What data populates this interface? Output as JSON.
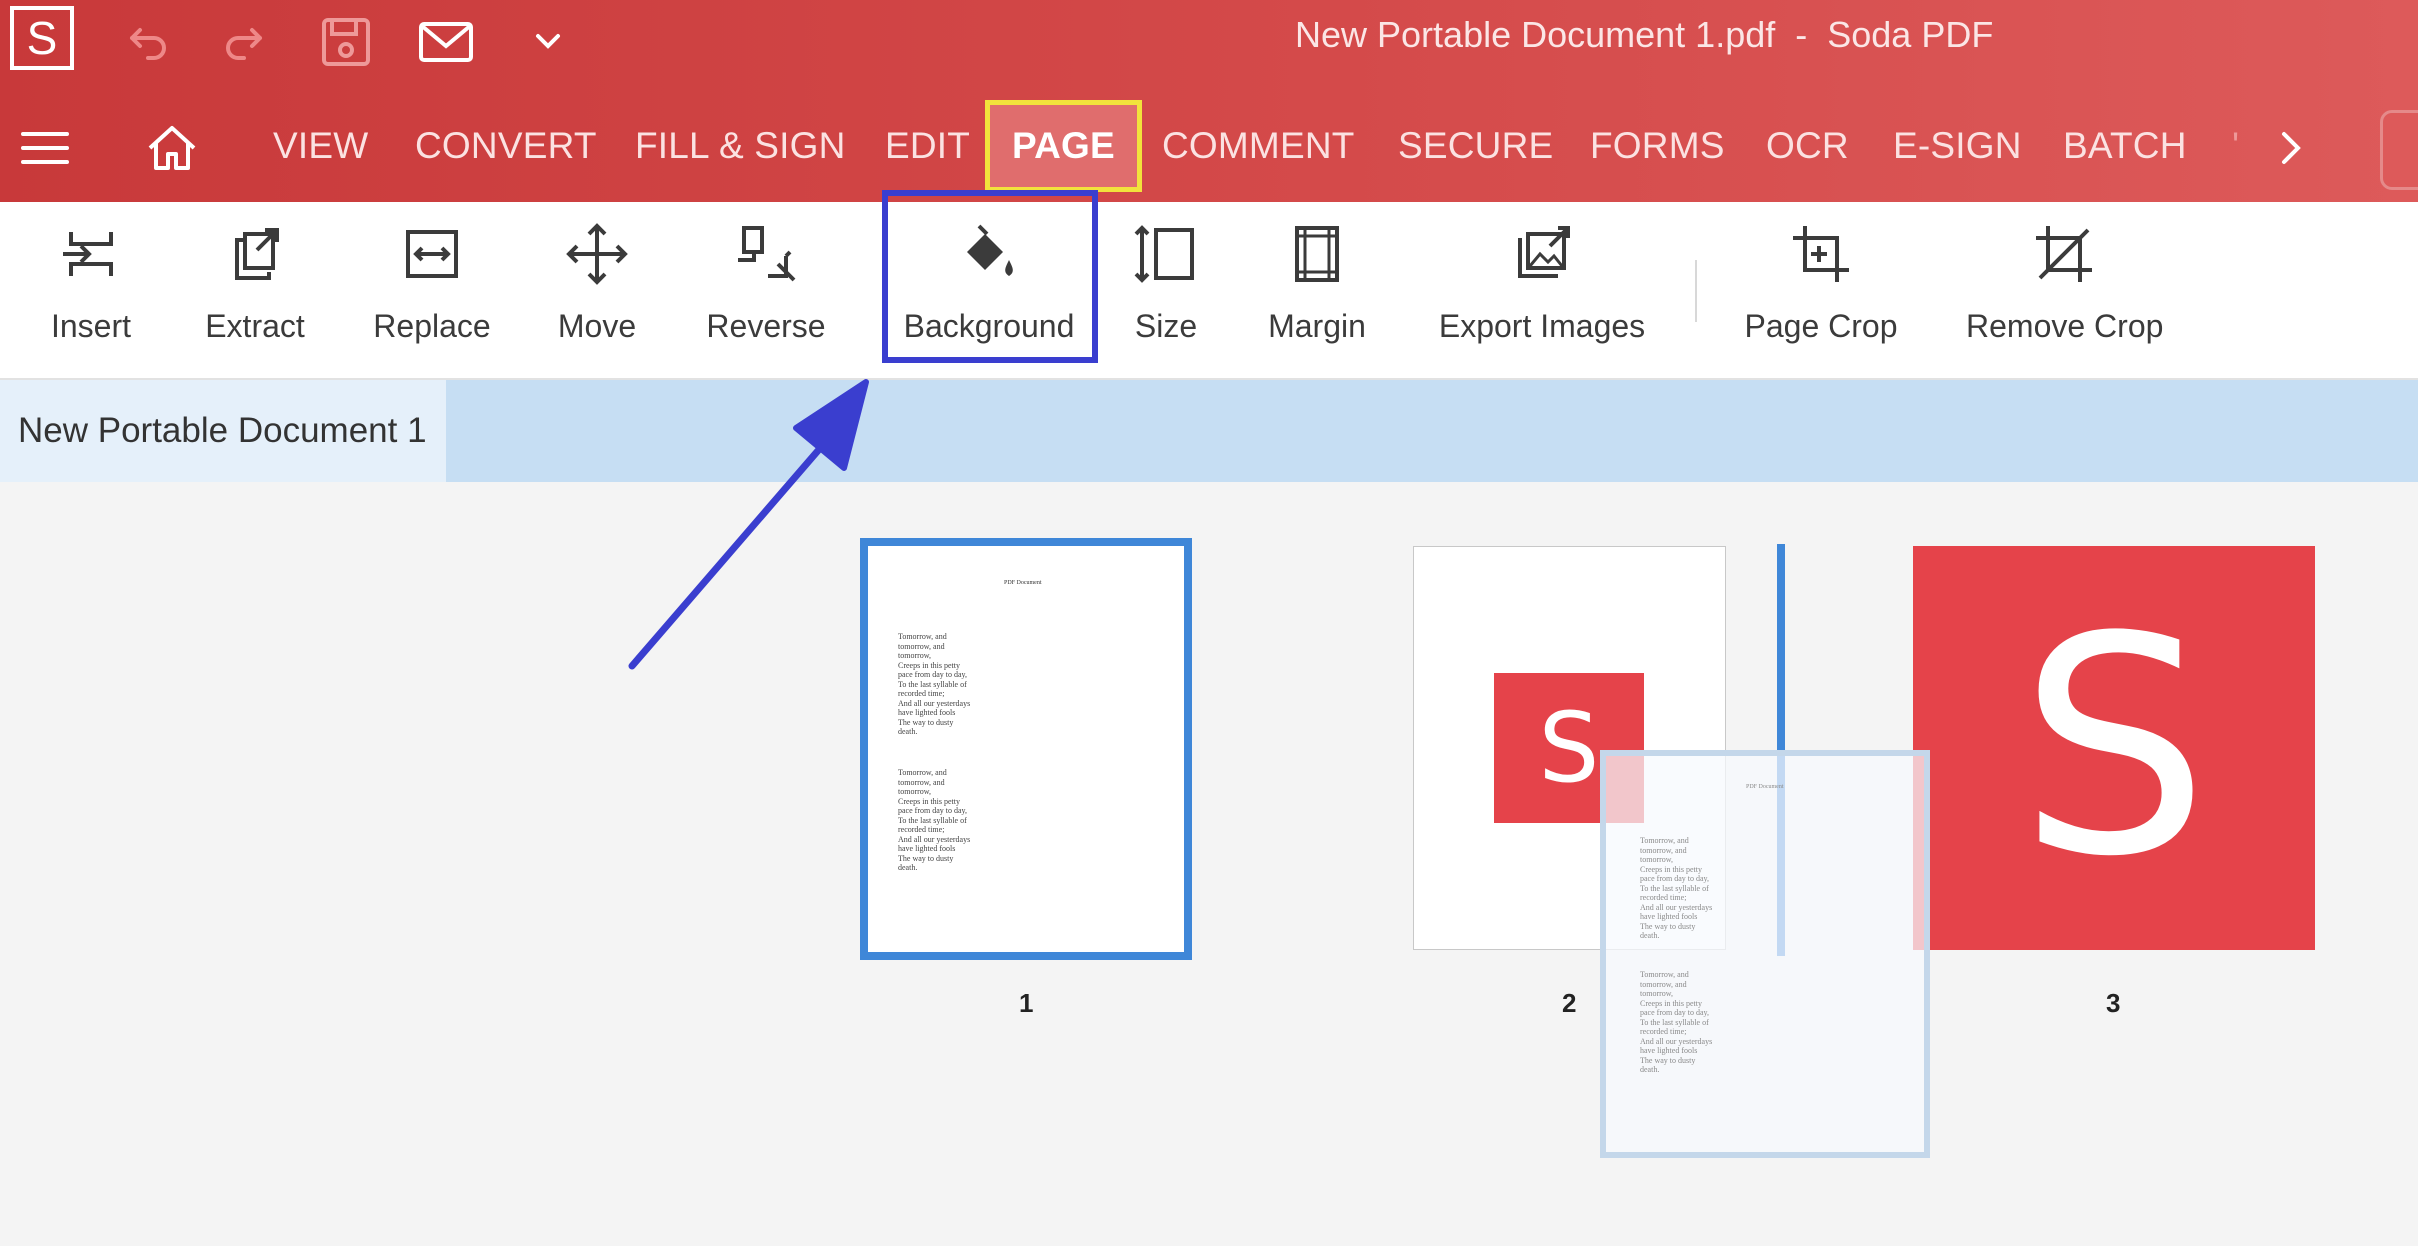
{
  "titlebar": {
    "logo": "S",
    "document_title": "New Portable Document 1.pdf  -  Soda PDF",
    "quick_access_icons": [
      "undo-icon",
      "redo-icon",
      "save-icon",
      "mail-icon",
      "chevron-down-icon"
    ]
  },
  "menu": {
    "items": [
      "VIEW",
      "CONVERT",
      "FILL & SIGN",
      "EDIT",
      "PAGE",
      "COMMENT",
      "SECURE",
      "FORMS",
      "OCR",
      "E-SIGN",
      "BATCH"
    ],
    "active": "PAGE",
    "overflow_char": "'",
    "left_icons": [
      "hamburger-menu-icon",
      "home-icon"
    ],
    "right_icon": "chevron-right-icon"
  },
  "ribbon": {
    "tools": [
      "Insert",
      "Extract",
      "Replace",
      "Move",
      "Reverse",
      "Background",
      "Size",
      "Margin",
      "Export Images",
      "Page Crop",
      "Remove Crop"
    ],
    "highlighted_tool": "Background"
  },
  "document_tab": {
    "label": "New Portable Document 1"
  },
  "pages": [
    {
      "number": "1",
      "title": "PDF Document",
      "paragraph_1": "Tomorrow, and\ntomorrow, and\ntomorrow,\nCreeps in this petty\npace from day to day,\nTo the last syllable of\nrecorded time;\nAnd all our yesterdays\nhave lighted fools\nThe way to dusty\ndeath.",
      "paragraph_2": "Tomorrow, and\ntomorrow, and\ntomorrow,\nCreeps in this petty\npace from day to day,\nTo the last syllable of\nrecorded time;\nAnd all our yesterdays\nhave lighted fools\nThe way to dusty\ndeath."
    },
    {
      "number": "2",
      "logo_letter": "S"
    },
    {
      "number": "3",
      "logo_letter": "S"
    }
  ],
  "colors": {
    "brand_red": "#d44a4a",
    "active_tab_border": "#f2e23c",
    "annotation_blue": "#3a3ecf",
    "selection_blue": "#3f87d8",
    "logo_red": "#e5434a"
  }
}
